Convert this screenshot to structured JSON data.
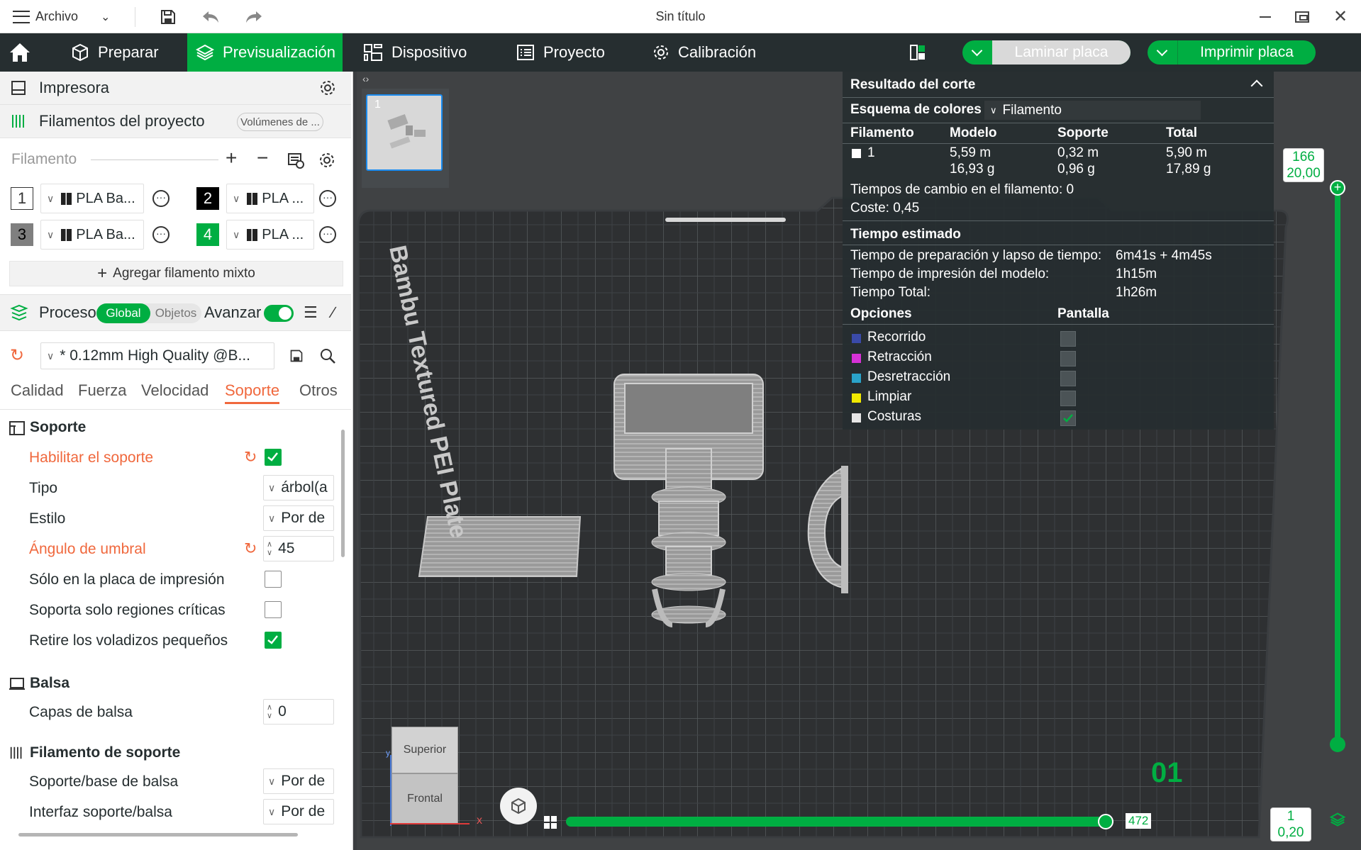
{
  "app": {
    "menu_label": "Archivo",
    "window_title": "Sin título"
  },
  "nav": {
    "tabs": [
      {
        "label": "Preparar"
      },
      {
        "label": "Previsualización"
      },
      {
        "label": "Dispositivo"
      },
      {
        "label": "Proyecto"
      },
      {
        "label": "Calibración"
      }
    ],
    "active_tab": "Previsualización",
    "slice_button": "Laminar placa",
    "print_button": "Imprimir placa"
  },
  "left": {
    "printer_label": "Impresora",
    "project_filaments_label": "Filamentos del proyecto",
    "volumes_button": "Volúmenes de ...",
    "filament_label": "Filamento",
    "filaments": [
      {
        "num": "1",
        "name": "PLA Ba..."
      },
      {
        "num": "2",
        "name": "PLA ..."
      },
      {
        "num": "3",
        "name": "PLA Ba..."
      },
      {
        "num": "4",
        "name": "PLA ..."
      }
    ],
    "add_mixed": "Agregar filamento mixto",
    "process_label": "Proceso",
    "global_label": "Global",
    "objects_label": "Objetos",
    "advanced_label": "Avanzar",
    "preset": "* 0.12mm High Quality @B...",
    "subtabs": [
      "Calidad",
      "Fuerza",
      "Velocidad",
      "Soporte",
      "Otros"
    ],
    "active_subtab": "Soporte",
    "groups": {
      "support": "Soporte",
      "raft": "Balsa",
      "support_filament": "Filamento de soporte"
    },
    "settings": {
      "enable_support": {
        "label": "Habilitar el soporte",
        "checked": true
      },
      "type": {
        "label": "Tipo",
        "value": "árbol(a"
      },
      "style": {
        "label": "Estilo",
        "value": "Por de"
      },
      "threshold_angle": {
        "label": "Ángulo de umbral",
        "value": "45"
      },
      "on_build_plate": {
        "label": "Sólo en la placa de impresión",
        "checked": false
      },
      "critical_only": {
        "label": "Soporta solo regiones críticas",
        "checked": false
      },
      "remove_small_overhangs": {
        "label": "Retire los voladizos pequeños",
        "checked": true
      },
      "raft_layers": {
        "label": "Capas de balsa",
        "value": "0"
      },
      "support_base": {
        "label": "Soporte/base de balsa",
        "value": "Por de"
      },
      "support_interface": {
        "label": "Interfaz soporte/balsa",
        "value": "Por de"
      }
    }
  },
  "viewport": {
    "plate_number": "1",
    "bed_label": "Bambu Textured PEI Plate",
    "plate_badge": "01",
    "view_cube_top": "Superior",
    "view_cube_front": "Frontal",
    "axis_x": "x",
    "axis_y": "y",
    "hslider_value": "472",
    "hslider_fraction": 1.0,
    "vslider_top_layer": "166",
    "vslider_top_height": "20,00",
    "vslider_bottom_layer": "1",
    "vslider_bottom_height": "0,20"
  },
  "slice_result": {
    "title": "Resultado del corte",
    "color_scheme_label": "Esquema de colores",
    "color_scheme_value": "Filamento",
    "columns": [
      "Filamento",
      "Modelo",
      "Soporte",
      "Total"
    ],
    "row": {
      "filament": "1",
      "model_len": "5,59 m",
      "model_weight": "16,93 g",
      "support_len": "0,32 m",
      "support_weight": "0,96 g",
      "total_len": "5,90 m",
      "total_weight": "17,89 g"
    },
    "change_times": "Tiempos de cambio en el filamento:  0",
    "cost": "Coste:  0,45",
    "est_time_title": "Tiempo estimado",
    "prep_label": "Tiempo de preparación y lapso de tiempo:",
    "prep_value": "6m41s + 4m45s",
    "print_label": "Tiempo de impresión del modelo:",
    "print_value": "1h15m",
    "total_label": "Tiempo Total:",
    "total_value": "1h26m",
    "options_label": "Opciones",
    "display_label": "Pantalla",
    "options": [
      {
        "label": "Recorrido",
        "color": "#3a4aa8",
        "checked": false
      },
      {
        "label": "Retracción",
        "color": "#d631d6",
        "checked": false
      },
      {
        "label": "Desretracción",
        "color": "#2aa3c9",
        "checked": false
      },
      {
        "label": "Limpiar",
        "color": "#f0e800",
        "checked": false
      },
      {
        "label": "Costuras",
        "color": "#e6e6e6",
        "checked": true
      }
    ]
  },
  "colors": {
    "accent": "#00ae42",
    "warning": "#f0683d",
    "nav_bg": "#262e30"
  }
}
